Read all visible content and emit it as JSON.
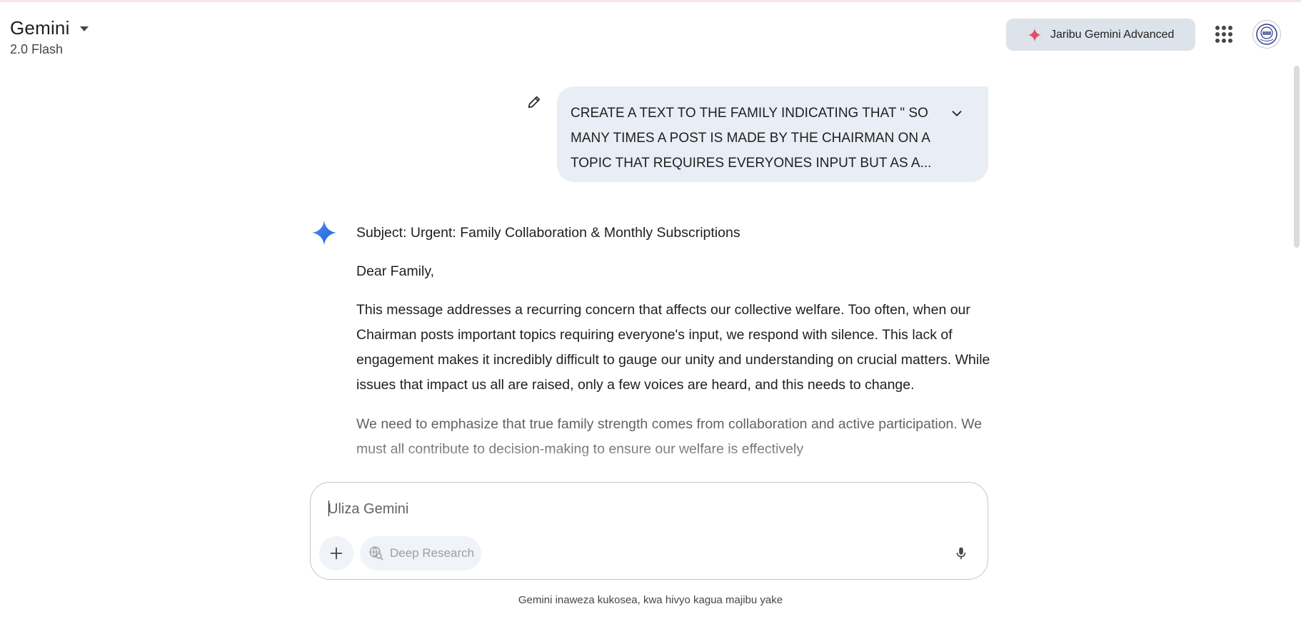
{
  "header": {
    "title": "Gemini",
    "model": "2.0 Flash",
    "try_advanced_label": "Jaribu Gemini Advanced",
    "accent_color": "#e34b63"
  },
  "conversation": {
    "user_prompt": "CREATE A TEXT TO THE FAMILY INDICATING THAT \" SO MANY TIMES A POST IS MADE BY THE CHAIRMAN ON A TOPIC THAT REQUIRES EVERYONES INPUT BUT AS A...",
    "response": {
      "subject": "Subject: Urgent: Family Collaboration & Monthly Subscriptions",
      "greeting": "Dear Family,",
      "paragraph_1": "This message addresses a recurring concern that affects our collective welfare. Too often, when our Chairman posts important topics requiring everyone's input, we respond with silence. This lack of engagement makes it incredibly difficult to gauge our unity and understanding on crucial matters. While issues that impact us all are raised, only a few voices are heard, and this needs to change.",
      "paragraph_2": "We need to emphasize that true family strength comes from collaboration and active participation. We must all contribute to decision-making to ensure our welfare is effectively"
    }
  },
  "composer": {
    "placeholder": "Uliza Gemini",
    "deep_research_label": "Deep Research"
  },
  "footer": {
    "disclaimer": "Gemini inaweza kukosea, kwa hivyo kagua majibu yake"
  },
  "icons": {
    "dropdown": "caret-down-icon",
    "spark": "gemini-spark-icon",
    "apps": "apps-grid-icon",
    "edit": "pencil-icon",
    "expand": "chevron-down-icon",
    "plus": "plus-icon",
    "deep_research": "globe-search-icon",
    "mic": "mic-icon"
  }
}
